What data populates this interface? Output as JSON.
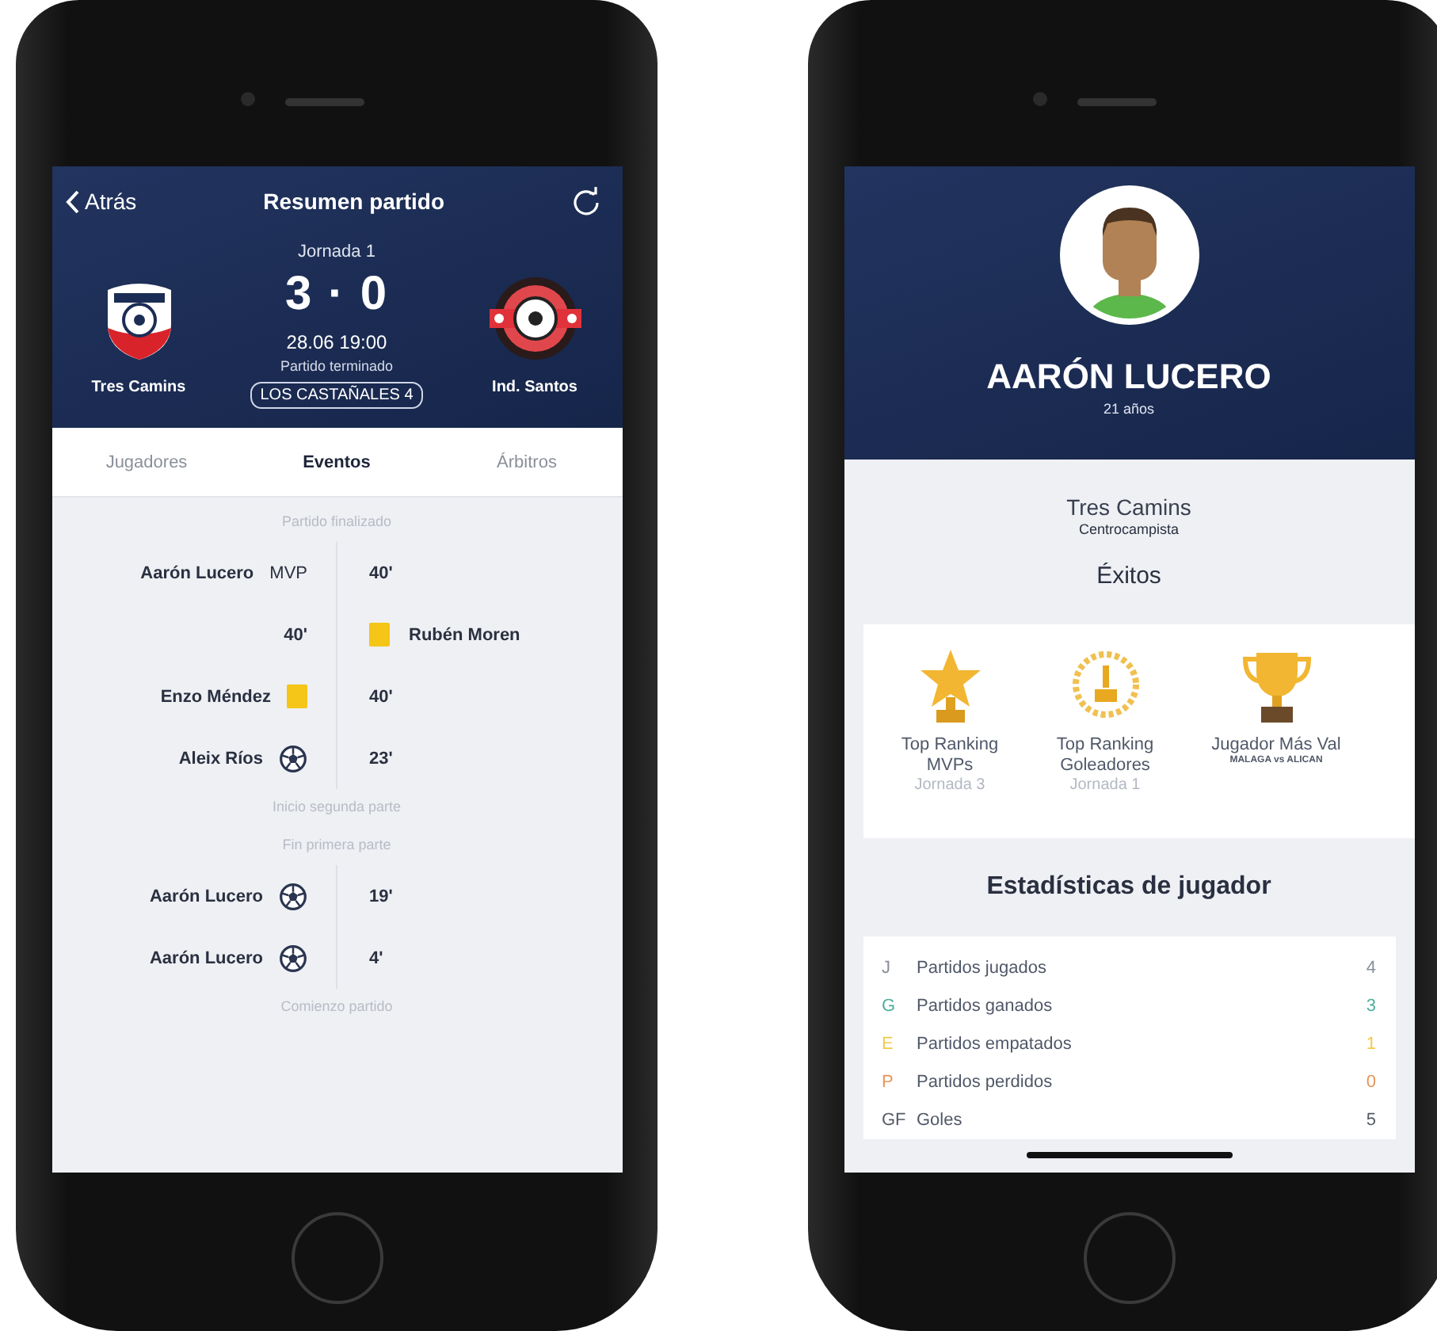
{
  "match_screen": {
    "nav": {
      "back": "Atrás",
      "title": "Resumen partido"
    },
    "round": "Jornada 1",
    "home_team": {
      "name": "Tres Camins"
    },
    "away_team": {
      "name": "Ind. Santos"
    },
    "score": "3 · 0",
    "datetime": "28.06 19:00",
    "status": "Partido terminado",
    "venue": "LOS CASTAÑALES 4",
    "tabs": [
      {
        "label": "Jugadores",
        "selected": false
      },
      {
        "label": "Eventos",
        "selected": true
      },
      {
        "label": "Árbitros",
        "selected": false
      }
    ],
    "timeline": [
      {
        "kind": "separator",
        "text": "Partido finalizado"
      },
      {
        "kind": "home",
        "player": "Aarón Lucero",
        "marker": {
          "kind": "mvp",
          "text": "MVP"
        },
        "minute": "40'"
      },
      {
        "kind": "away",
        "player": "Rubén Moren",
        "marker": {
          "kind": "card"
        },
        "minute": "40'"
      },
      {
        "kind": "home",
        "player": "Enzo Méndez",
        "marker": {
          "kind": "card"
        },
        "minute": "40'"
      },
      {
        "kind": "home",
        "player": "Aleix Ríos",
        "marker": {
          "kind": "goal"
        },
        "minute": "23'"
      },
      {
        "kind": "separator",
        "text": "Inicio segunda parte"
      },
      {
        "kind": "separator",
        "text": "Fin primera parte"
      },
      {
        "kind": "home",
        "player": "Aarón Lucero",
        "marker": {
          "kind": "goal"
        },
        "minute": "19'"
      },
      {
        "kind": "home",
        "player": "Aarón Lucero",
        "marker": {
          "kind": "goal"
        },
        "minute": "4'"
      },
      {
        "kind": "separator",
        "text": "Comienzo partido"
      }
    ]
  },
  "player_screen": {
    "name": "AARÓN LUCERO",
    "age": "21 años",
    "team": "Tres Camins",
    "position": "Centrocampista",
    "achievements_title": "Éxitos",
    "achievements": [
      {
        "kind": "star_trophy",
        "title": "Top Ranking MVPs",
        "subtitle": "Jornada 3"
      },
      {
        "kind": "medal",
        "title": "Top Ranking Goleadores",
        "subtitle": "Jornada 1"
      },
      {
        "kind": "cup",
        "title": "Jugador Más Val",
        "match": "MALAGA vs ALICAN"
      }
    ],
    "stats_title": "Estadísticas de jugador",
    "stats": [
      {
        "abbr": "J",
        "label": "Partidos jugados",
        "value": "4",
        "color": "#8a8f99"
      },
      {
        "abbr": "G",
        "label": "Partidos ganados",
        "value": "3",
        "color": "#4fae9c"
      },
      {
        "abbr": "E",
        "label": "Partidos empatados",
        "value": "1",
        "color": "#f2c94c"
      },
      {
        "abbr": "P",
        "label": "Partidos perdidos",
        "value": "0",
        "color": "#e8955a"
      },
      {
        "abbr": "GF",
        "label": "Goles",
        "value": "5",
        "color": "#555a66"
      }
    ]
  }
}
